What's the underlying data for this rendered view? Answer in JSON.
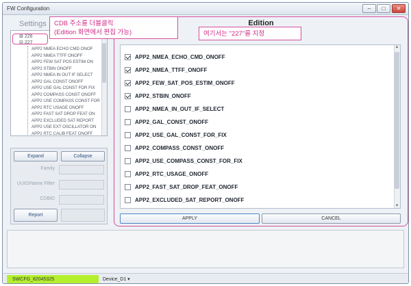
{
  "window": {
    "title": "FW Configuration",
    "controls": {
      "minimize": "–",
      "maximize": "□",
      "close": "✕"
    }
  },
  "settings": {
    "label": "Settings",
    "tree": {
      "nodes": [
        {
          "expander": "⊞",
          "label": "226"
        },
        {
          "expander": "⊟",
          "label": "227"
        }
      ],
      "children": [
        "APP2 NMEA ECHO CMD ONOF",
        "APP2 NMEA TTFF ONOFF",
        "APP2 FEW SAT POS ESTIM ON",
        "APP2 STBIN ONOFF",
        "APP2 NMEA IN OUT IF SELECT",
        "APP2 GAL CONST ONOFF",
        "APP2 USE GAL CONST FOR FIX",
        "APP2 COMPASS CONST ONOFF",
        "APP2 USE COMPASS CONST FOR",
        "APP2 RTC USAGE ONOFF",
        "APP2 FAST SAT DROP FEAT ON",
        "APP2 EXCLUDED SAT REPORT",
        "APP2 USE EXT OSCILLATOR ON",
        "APP2 RTC CALIB FEAT ONOFF"
      ]
    },
    "expand_label": "Expand",
    "collapse_label": "Collapse",
    "family_label": "Family",
    "uuid_label": "UUID/Name Filter",
    "cdbid_label": "CDBID",
    "report_label": "Report"
  },
  "callouts": {
    "cdb": {
      "line1": "CDB 주소를 더블클릭",
      "line2": "(Edition 화면에서 편집 가능)"
    },
    "edition": "여기서는 \"227\"를 지정"
  },
  "edition": {
    "title": "Edition",
    "items": [
      {
        "label": "APP2_NMEA_ECHO_CMD_ONOFF",
        "checked": true
      },
      {
        "label": "APP2_NMEA_TTFF_ONOFF",
        "checked": true
      },
      {
        "label": "APP2_FEW_SAT_POS_ESTIM_ONOFF",
        "checked": true
      },
      {
        "label": "APP2_STBIN_ONOFF",
        "checked": true
      },
      {
        "label": "APP2_NMEA_IN_OUT_IF_SELECT",
        "checked": false
      },
      {
        "label": "APP2_GAL_CONST_ONOFF",
        "checked": false
      },
      {
        "label": "APP2_USE_GAL_CONST_FOR_FIX",
        "checked": false
      },
      {
        "label": "APP2_COMPASS_CONST_ONOFF",
        "checked": false
      },
      {
        "label": "APP2_USE_COMPASS_CONST_FOR_FIX",
        "checked": false
      },
      {
        "label": "APP2_RTC_USAGE_ONOFF",
        "checked": false
      },
      {
        "label": "APP2_FAST_SAT_DROP_FEAT_ONOFF",
        "checked": false
      },
      {
        "label": "APP2_EXCLUDED_SAT_REPORT_ONOFF",
        "checked": false
      }
    ],
    "apply_label": "APPLY",
    "cancel_label": "CANCEL"
  },
  "status": {
    "config_file": "SWCFG_82045325",
    "device": "Device_D1 ▾"
  },
  "colors": {
    "accent": "#d64f9c",
    "status_green": "#b4ef2e"
  }
}
